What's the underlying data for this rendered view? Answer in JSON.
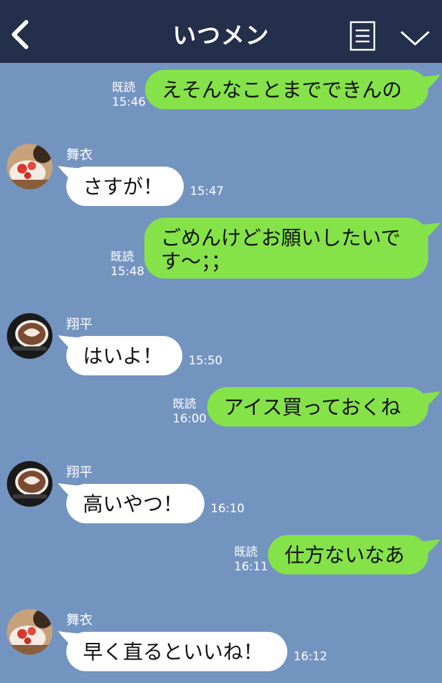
{
  "header": {
    "title": "いつメン",
    "icons": {
      "back": "chevron-left-icon",
      "menu": "note-icon",
      "expand": "chevron-down-icon"
    }
  },
  "messages": [
    {
      "side": "me",
      "text": "えそんなことまでできんの",
      "read": "既読",
      "time": "15:46"
    },
    {
      "side": "other",
      "sender": "舞衣",
      "avatar": "cake-avatar",
      "text": "さすが！",
      "time": "15:47"
    },
    {
      "side": "me",
      "text": "ごめんけどお願いしたいです〜；；",
      "read": "既読",
      "time": "15:48"
    },
    {
      "side": "other",
      "sender": "翔平",
      "avatar": "latte-avatar",
      "text": "はいよ！",
      "time": "15:50"
    },
    {
      "side": "me",
      "text": "アイス買っておくね",
      "read": "既読",
      "time": "16:00"
    },
    {
      "side": "other",
      "sender": "翔平",
      "avatar": "latte-avatar",
      "text": "高いやつ！",
      "time": "16:10"
    },
    {
      "side": "me",
      "text": "仕方ないなあ",
      "read": "既読",
      "time": "16:11"
    },
    {
      "side": "other",
      "sender": "舞衣",
      "avatar": "cake-avatar",
      "text": "早く直るといいね！",
      "time": "16:12"
    }
  ],
  "colors": {
    "background": "#7494c0",
    "header": "#232f4b",
    "my_bubble": "#85e249",
    "their_bubble": "#ffffff"
  }
}
